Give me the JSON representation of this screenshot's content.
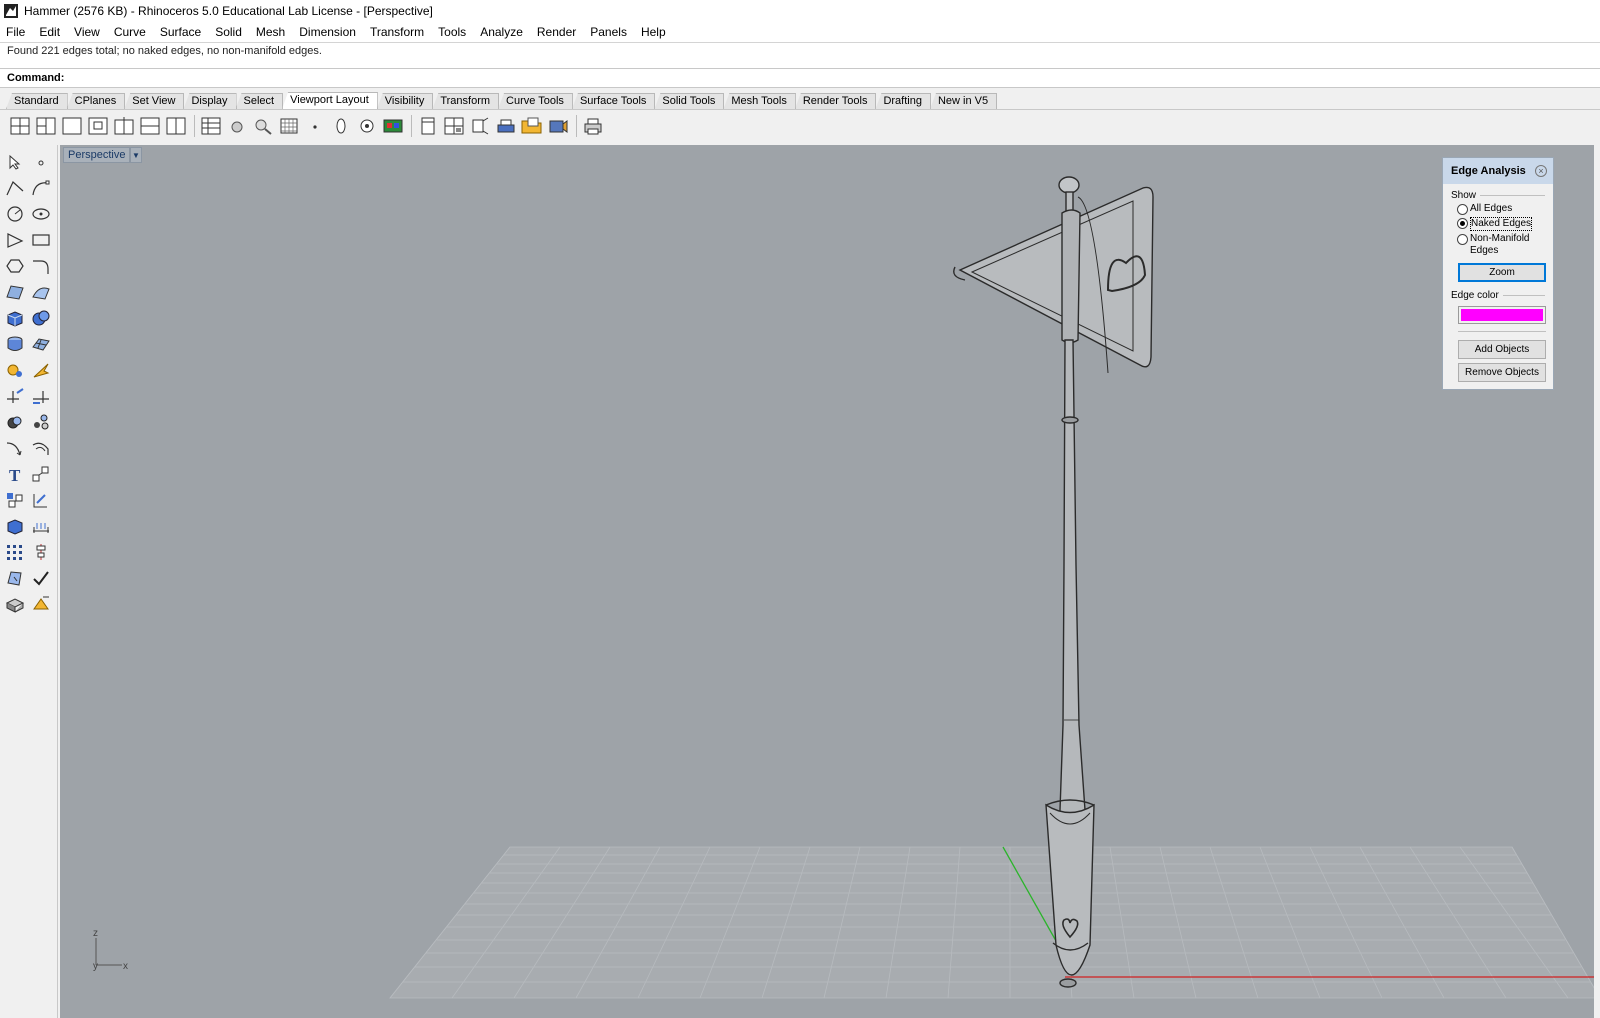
{
  "window": {
    "title": "Hammer (2576 KB) - Rhinoceros 5.0 Educational Lab License - [Perspective]"
  },
  "menu": [
    "File",
    "Edit",
    "View",
    "Curve",
    "Surface",
    "Solid",
    "Mesh",
    "Dimension",
    "Transform",
    "Tools",
    "Analyze",
    "Render",
    "Panels",
    "Help"
  ],
  "command": {
    "history": "Found 221 edges total; no naked edges, no non-manifold edges.",
    "label": "Command:",
    "value": ""
  },
  "toolbar_tabs": [
    "Standard",
    "CPlanes",
    "Set View",
    "Display",
    "Select",
    "Viewport Layout",
    "Visibility",
    "Transform",
    "Curve Tools",
    "Surface Tools",
    "Solid Tools",
    "Mesh Tools",
    "Render Tools",
    "Drafting",
    "New in V5"
  ],
  "active_tab": "Viewport Layout",
  "viewport": {
    "name": "Perspective",
    "axis_labels": {
      "z": "z",
      "y": "y",
      "x": "x"
    },
    "bg_color": "#9ea3a8"
  },
  "edge_panel": {
    "title": "Edge Analysis",
    "show_label": "Show",
    "options": [
      "All Edges",
      "Naked Edges",
      "Non-Manifold Edges"
    ],
    "selected": "Naked Edges",
    "zoom_label": "Zoom",
    "edge_color_label": "Edge color",
    "edge_color": "#ff00ff",
    "add_label": "Add Objects",
    "remove_label": "Remove Objects"
  }
}
